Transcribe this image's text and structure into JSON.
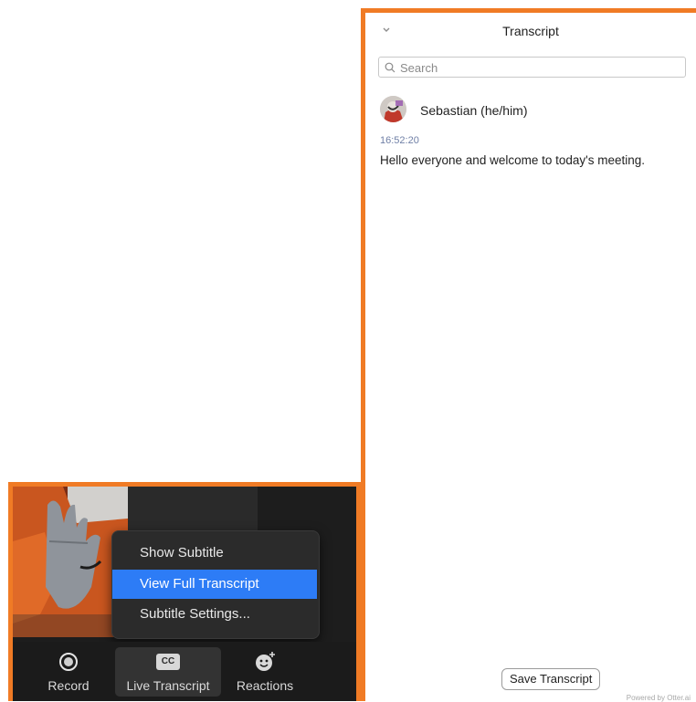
{
  "panel": {
    "title": "Transcript",
    "search_placeholder": "Search",
    "entries": [
      {
        "speaker": "Sebastian (he/him)",
        "time": "16:52:20",
        "text": "Hello everyone and welcome to today's meeting."
      }
    ],
    "save_label": "Save Transcript",
    "powered_by": "Powered by Otter.ai"
  },
  "menu": {
    "items": [
      {
        "label": "Show Subtitle",
        "selected": false
      },
      {
        "label": "View Full Transcript",
        "selected": true
      },
      {
        "label": "Subtitle Settings...",
        "selected": false
      }
    ]
  },
  "toolbar": {
    "record_label": "Record",
    "live_transcript_label": "Live Transcript",
    "cc_text": "CC",
    "reactions_label": "Reactions"
  },
  "colors": {
    "highlight_border": "#f07b25",
    "menu_selected": "#2d7cf6",
    "timestamp": "#6f7fa6"
  },
  "icons": [
    "chevron-down-icon",
    "search-icon",
    "record-icon",
    "cc-icon",
    "reactions-icon"
  ]
}
